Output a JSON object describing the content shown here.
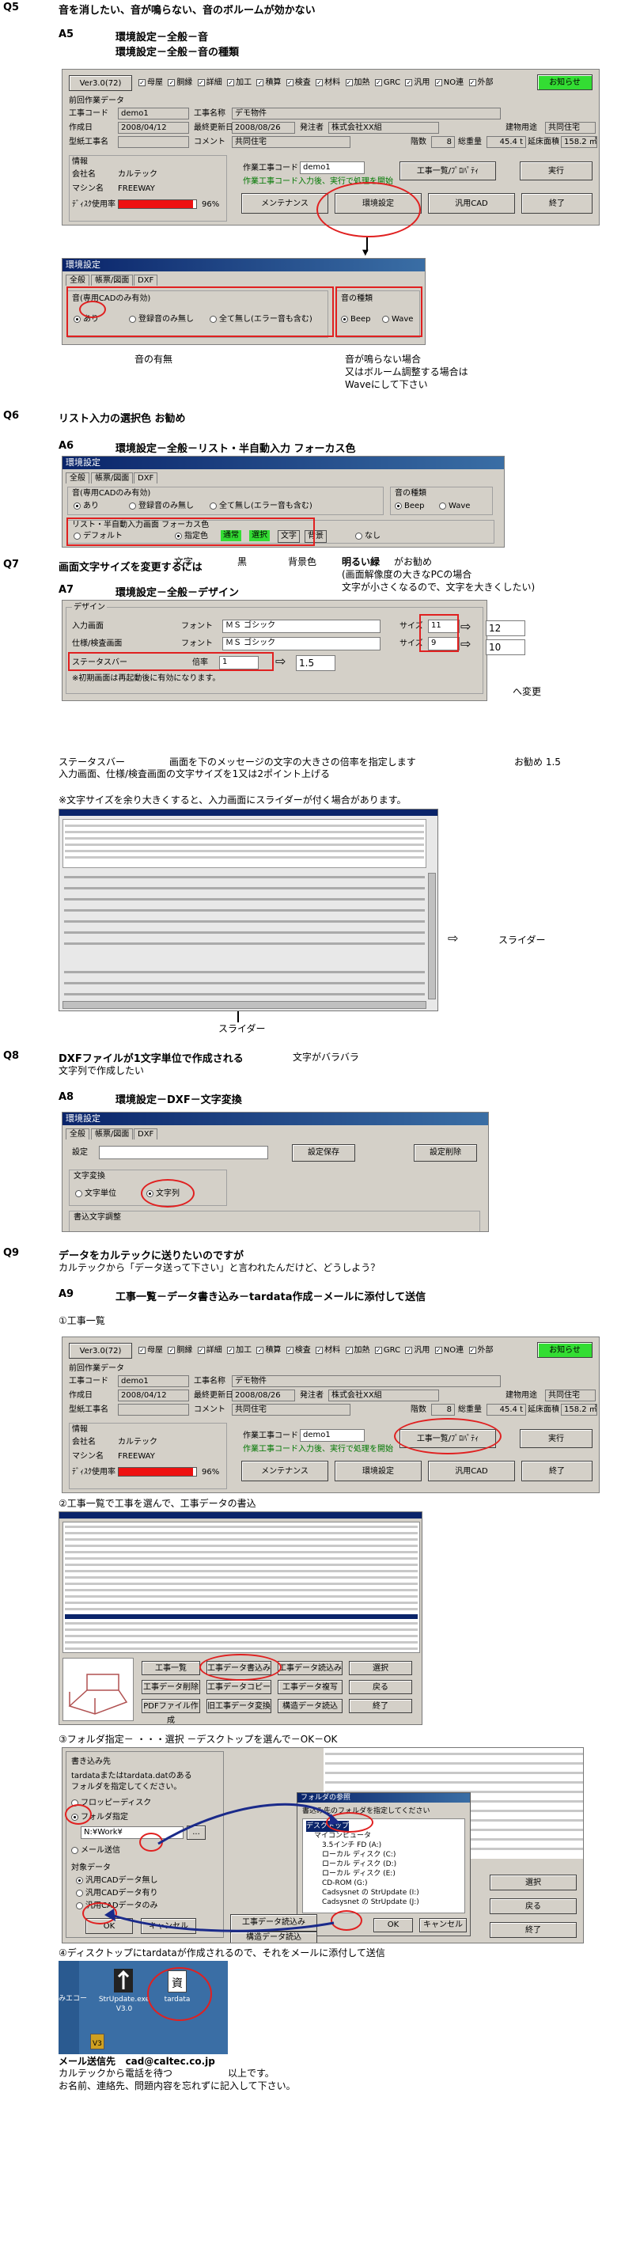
{
  "q5": {
    "num": "Q5",
    "question": "音を消したい、音が鳴らない、音のボルームが効かない",
    "a_num": "A5",
    "a_line1": "環境設定－全般－音",
    "a_line2": "環境設定－全般－音の種類"
  },
  "main_app": {
    "version": "Ver3.0(72)",
    "checks": [
      "母屋",
      "胴縁",
      "詳細",
      "加工",
      "積算",
      "検査",
      "材料",
      "加熱",
      "GRC",
      "汎用",
      "NO連",
      "外部"
    ],
    "notice_button": "お知らせ",
    "section": "前回作業データ",
    "work_code_label": "工事コード",
    "work_code": "demo1",
    "work_name_label": "工事名称",
    "work_name": "デモ物件",
    "created_label": "作成日",
    "created": "2008/04/12",
    "updated_label": "最終更新日",
    "updated": "2008/08/26",
    "orderer_label": "発注者",
    "orderer": "株式会社XX組",
    "site_label": "建物用途",
    "site": "共同住宅",
    "process_label": "型紙工事名",
    "comment_label": "コメント",
    "comment": "共同住宅",
    "floors_label": "階数",
    "floors": "8",
    "weight_label": "総重量",
    "weight": "45.4 t",
    "area_label": "延床面積",
    "area": "158.2 ㎡",
    "info_label": "情報",
    "company_label": "会社名",
    "company": "カルテック",
    "machine_label": "マシン名",
    "machine": "FREEWAY",
    "disk_label": "ﾃﾞｨｽｸ使用率",
    "disk": "96%",
    "disk_used": 0.96,
    "input_code_label": "作業工事コード",
    "input_code": "demo1",
    "hint": "作業工事コード入力後、実行で処理を開始",
    "btn_list": "工事一覧/ﾌﾟﾛﾊﾟﾃｨ",
    "btn_run": "実行",
    "btn_maint": "メンテナンス",
    "btn_env": "環境設定",
    "btn_cad": "汎用CAD",
    "btn_exit": "終了"
  },
  "env1": {
    "title": "環境設定",
    "tabs": [
      "全般",
      "帳票/図面",
      "DXF"
    ],
    "sound_group": "音(専用CADのみ有効)",
    "sound_opts": [
      "あり",
      "登録音のみ無し",
      "全て無し(エラー音も含む)"
    ],
    "type_group": "音の種類",
    "type_opts": [
      "Beep",
      "Wave"
    ],
    "note_left": "音の有無",
    "note_right1": "音が鳴らない場合",
    "note_right2": "又はボルーム調整する場合は",
    "note_right3": "Waveにして下さい"
  },
  "q6": {
    "num": "Q6",
    "question": "リスト入力の選択色 お勧め",
    "a_num": "A6",
    "answer": "環境設定－全般－リスト・半自動入力 フォーカス色"
  },
  "env2": {
    "title": "環境設定",
    "tabs": [
      "全般",
      "帳票/図面",
      "DXF"
    ],
    "sound_group": "音(専用CADのみ有効)",
    "sound_opts": [
      "あり",
      "登録音のみ無し",
      "全て無し(エラー音も含む)"
    ],
    "type_group": "音の種類",
    "type_opts": [
      "Beep",
      "Wave"
    ],
    "focus_group": "リスト・半自動入力画面 フォーカス色",
    "focus_opts": [
      "デフォルト",
      "指定色",
      "なし"
    ],
    "color_labels": [
      "通常",
      "選択",
      "文字",
      "背景"
    ]
  },
  "q6_note": {
    "c1": "文字",
    "c2": "黒",
    "c3": "背景色",
    "c4": "明るい緑",
    "c5": "がお勧め",
    "line2": "(画面解像度の大きなPCの場合",
    "line3": "文字が小さくなるので、文字を大きくしたい)"
  },
  "q7": {
    "num": "Q7",
    "question": "画面文字サイズを変更するには",
    "a_num": "A7",
    "answer": "環境設定－全般－デザイン"
  },
  "design": {
    "group": "デザイン",
    "input_label": "入力画面",
    "spec_label": "仕様/検査画面",
    "font_label": "フォント",
    "font_value": "ＭＳ ゴシック",
    "size_label": "サイズ",
    "size1": "11",
    "size2": "9",
    "status_label": "ステータスバー",
    "ratio_label": "倍率",
    "ratio": "1",
    "note": "※初期画面は再起動後に有効になります。",
    "new1": "12",
    "new2": "10",
    "new3": "1.5",
    "change": "へ変更"
  },
  "q7_note": {
    "status_line_a": "ステータスバー",
    "status_line_b": "画面を下のメッセージの文字の大きさの倍率を指定します",
    "status_line_c": "お勧め 1.5",
    "line2": "入力画面、仕様/検査画面の文字サイズを1又は2ポイント上げる",
    "warn": "※文字サイズを余り大きくすると、入力画面にスライダーが付く場合があります。",
    "slider_right": "スライダー",
    "slider_bottom": "スライダー"
  },
  "q8": {
    "num": "Q8",
    "question": "DXFファイルが1文字単位で作成される",
    "question2": "文字がバラバラ",
    "question3": "文字列で作成したい",
    "a_num": "A8",
    "answer": "環境設定－DXF－文字変換"
  },
  "dxf": {
    "title": "環境設定",
    "tabs": [
      "全般",
      "帳票/図面",
      "DXF"
    ],
    "setting_label": "設定",
    "save_btn": "設定保存",
    "delete_btn": "設定削除",
    "convert_group": "文字変換",
    "opts": [
      "文字単位",
      "文字列"
    ],
    "adjust_group": "書込文字調整"
  },
  "q9": {
    "num": "Q9",
    "question": "データをカルテックに送りたいのですが",
    "question2": "カルテックから「データ送って下さい」と言われたんだけど、どうしよう？",
    "a_num": "A9",
    "answer": "工事一覧－データ書き込み－tardata作成－メールに添付して送信"
  },
  "steps": {
    "s1": "①工事一覧",
    "s2": "②工事一覧で工事を選んで、工事データの書込",
    "s3": "③フォルダ指定－ ・・・選択 －デスクトップを選んで－OK－OK",
    "s4": "④ディスクトップにtardataが作成されるので、それをメールに添付して送信"
  },
  "list_dialog": {
    "buttons": [
      "工事一覧",
      "工事データ書込み",
      "工事データ読込み",
      "工事データ削除",
      "工事データコピー",
      "工事データ複写",
      "PDFファイル作成",
      "旧工事データ変換",
      "構造データ読込",
      "選択",
      "戻る",
      "終了"
    ]
  },
  "write_dialog": {
    "title": "書き込み先",
    "desc1": "tardataまたはtardata.datのある",
    "desc2": "フォルダを指定してください。",
    "fd": "フロッピーディスク",
    "folder": "フォルダ指定",
    "path": "N:¥Work¥",
    "mail": "メール送信",
    "target": "対象データ",
    "t1": "汎用CADデータ無し",
    "t2": "汎用CADデータ有り",
    "t3": "汎用CADデータのみ",
    "ok": "OK",
    "cancel": "キャンセル",
    "browse": "..."
  },
  "folder_dialog": {
    "title": "フォルダの参照",
    "desc": "書込み先のフォルダを指定してください",
    "items": [
      "デスクトップ",
      "マイコンピュータ",
      "3.5インチ FD (A:)",
      "ローカル ディスク (C:)",
      "ローカル ディスク (D:)",
      "ローカル ディスク (E:)",
      "CD-ROM (G:)",
      "Cadsysnet の StrUpdate (I:)",
      "Cadsysnet の StrUpdate (J:)"
    ],
    "ok": "OK",
    "cancel": "キャンセル"
  },
  "desktop": {
    "icon1": "StrUpdate.exe",
    "icon1b": "V3.0",
    "icon2": "tardata",
    "icon3": "みエコー"
  },
  "mail": {
    "line1_label": "メール送信先",
    "line1_value": "cad@caltec.co.jp",
    "line2": "カルテックから電話を待つ",
    "line2b": "以上です。",
    "line3": "お名前、連絡先、問題内容を忘れずに記入して下さい。"
  },
  "colors": {
    "accent_red": "#e02020",
    "notice_green": "#33dd33",
    "win_gray": "#d4d0c8",
    "title_blue": "#0a246a",
    "disk_red": "#ee1111"
  }
}
